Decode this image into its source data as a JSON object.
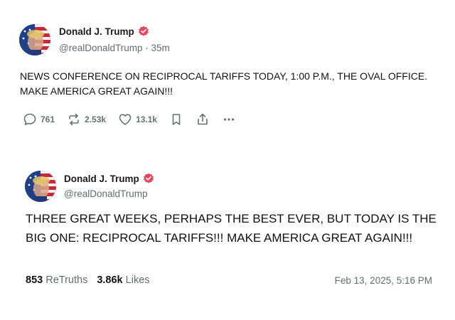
{
  "post1": {
    "author_name": "Donald J. Trump",
    "handle": "@realDonaldTrump",
    "separator": "·",
    "time_ago": "35m",
    "text": "NEWS CONFERENCE ON RECIPROCAL TARIFFS TODAY, 1:00 P.M., THE OVAL OFFICE. MAKE AMERICA GREAT AGAIN!!!",
    "actions": {
      "replies": "761",
      "retruths": "2.53k",
      "likes": "13.1k"
    }
  },
  "post2": {
    "author_name": "Donald J. Trump",
    "handle": "@realDonaldTrump",
    "text": "THREE GREAT WEEKS, PERHAPS THE BEST EVER, BUT TODAY IS THE BIG ONE: RECIPROCAL TARIFFS!!! MAKE AMERICA GREAT AGAIN!!!",
    "retruths_count": "853",
    "retruths_label": "ReTruths",
    "likes_count": "3.86k",
    "likes_label": "Likes",
    "timestamp": "Feb 13, 2025, 5:16 PM"
  },
  "icons": {
    "reply": "speech-bubble-icon",
    "retruth": "repost-arrows-icon",
    "like": "heart-icon",
    "bookmark": "bookmark-icon",
    "share": "share-upload-icon",
    "more": "ellipsis-icon",
    "verified": "verified-badge-icon"
  },
  "colors": {
    "verified_badge": "#e8465f",
    "muted_text": "#666a70",
    "icon_gray": "#6b6f75"
  }
}
